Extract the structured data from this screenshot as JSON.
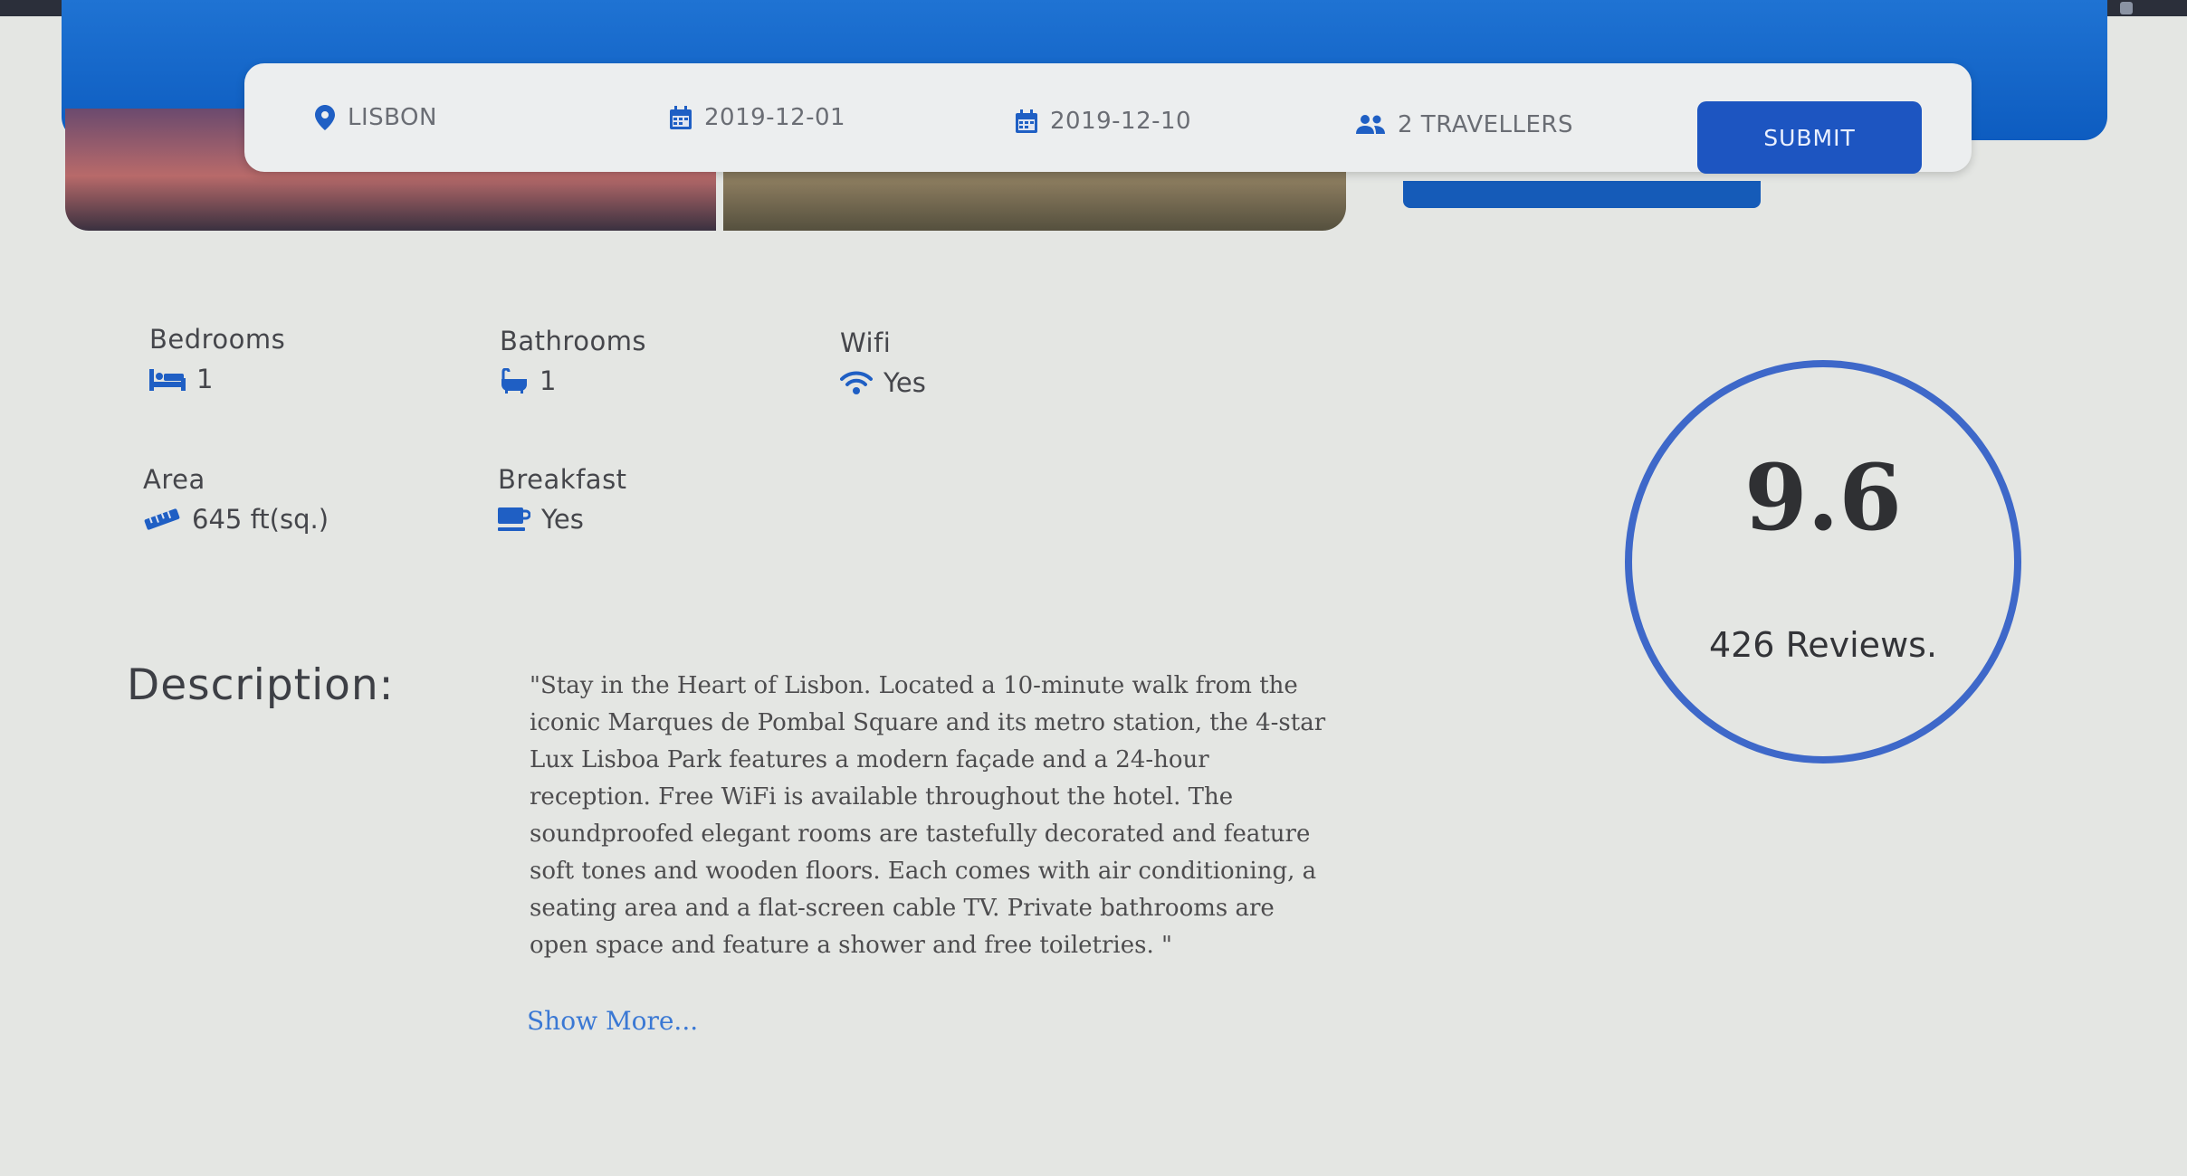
{
  "search": {
    "location": "LISBON",
    "checkin": "2019-12-01",
    "checkout": "2019-12-10",
    "travellers": "2 TRAVELLERS",
    "submit_label": "SUBMIT"
  },
  "amenities": {
    "bedrooms": {
      "label": "Bedrooms",
      "value": "1",
      "icon": "bed-icon"
    },
    "bathrooms": {
      "label": "Bathrooms",
      "value": "1",
      "icon": "bathtub-icon"
    },
    "wifi": {
      "label": "Wifi",
      "value": "Yes",
      "icon": "wifi-icon"
    },
    "area": {
      "label": "Area",
      "value": "645 ft(sq.)",
      "icon": "ruler-icon"
    },
    "breakfast": {
      "label": "Breakfast",
      "value": "Yes",
      "icon": "coffee-cup-icon"
    }
  },
  "description": {
    "heading": "Description:",
    "text": "\"Stay in the Heart of Lisbon. Located a 10-minute walk from the iconic Marques de Pombal Square and its metro station, the 4-star Lux Lisboa Park features a modern façade and a 24-hour reception. Free WiFi is available throughout the hotel. The soundproofed elegant rooms are tastefully decorated and feature soft tones and wooden floors. Each comes with air conditioning, a seating area and a flat-screen cable TV. Private bathrooms are open space and feature a shower and free toiletries. \"",
    "show_more_label": "Show More..."
  },
  "rating": {
    "score": "9.6",
    "reviews": "426 Reviews."
  },
  "colors": {
    "brand_blue": "#1f73d3",
    "submit_blue": "#1d55c1",
    "rating_ring": "#3e68c9",
    "link_blue": "#3a78d4"
  }
}
